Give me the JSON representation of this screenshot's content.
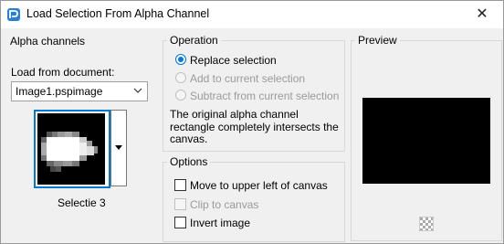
{
  "window": {
    "title": "Load Selection From Alpha Channel",
    "close_glyph": "✕"
  },
  "alpha": {
    "group_label": "Alpha channels",
    "load_label": "Load from document:",
    "document_value": "Image1.pspimage",
    "thumbnail_caption": "Selectie 3"
  },
  "operation": {
    "group_label": "Operation",
    "options": [
      {
        "label": "Replace selection",
        "checked": true,
        "enabled": true
      },
      {
        "label": "Add to current selection",
        "checked": false,
        "enabled": false
      },
      {
        "label": "Subtract from current selection",
        "checked": false,
        "enabled": false
      }
    ],
    "description": "The original alpha channel rectangle completely intersects the canvas."
  },
  "options": {
    "group_label": "Options",
    "items": [
      {
        "label": "Move to upper left of canvas",
        "checked": false,
        "enabled": true
      },
      {
        "label": "Clip to canvas",
        "checked": false,
        "enabled": false
      },
      {
        "label": "Invert image",
        "checked": false,
        "enabled": true
      }
    ]
  },
  "preview": {
    "group_label": "Preview",
    "background_color": "#000000"
  },
  "colors": {
    "accent": "#0078d7",
    "disabled_text": "#9a9a9a"
  },
  "icons": {
    "app": "psp-app-icon",
    "dropdown": "chevron-down-icon",
    "thumb_menu": "triangle-down-icon",
    "transparency": "checkerboard-icon"
  }
}
